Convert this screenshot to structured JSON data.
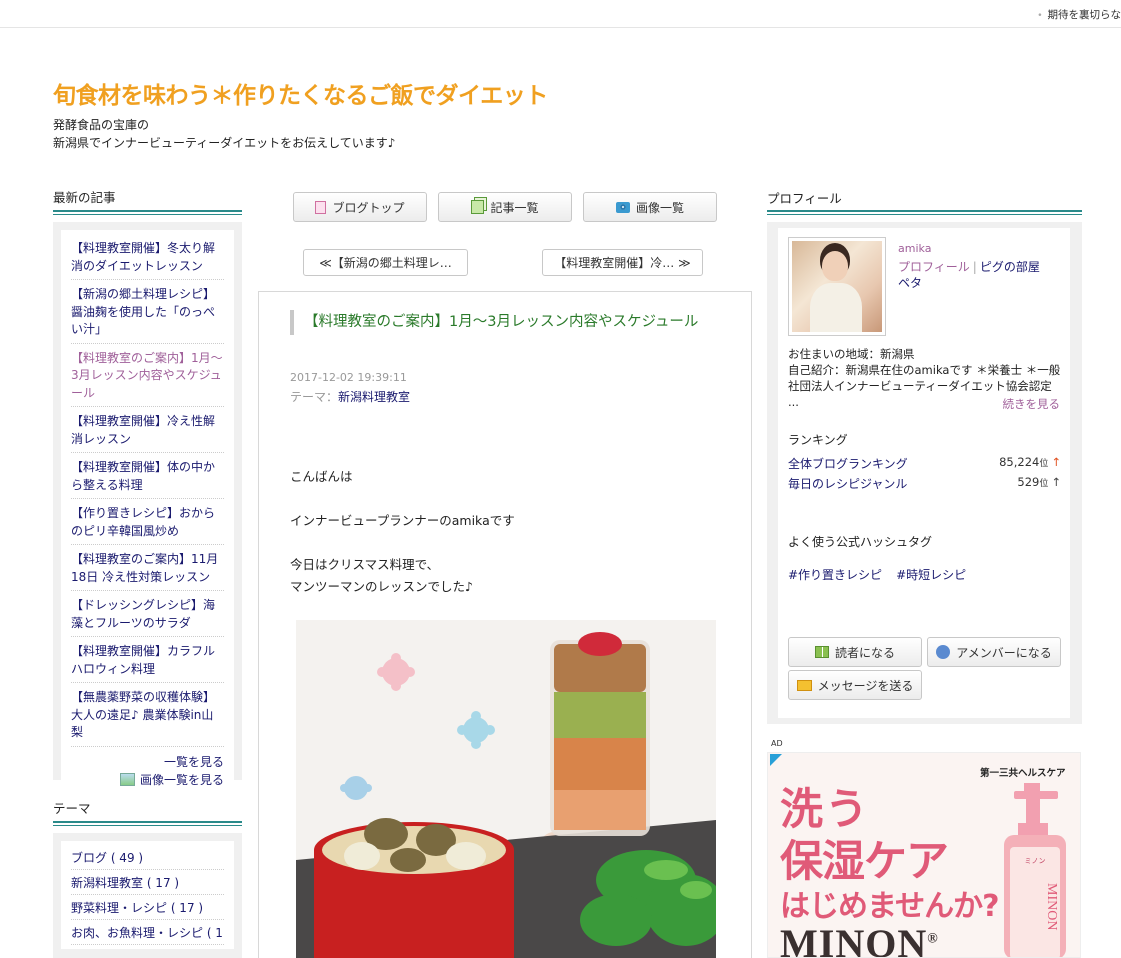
{
  "topbar": {
    "notice": "期待を裏切らな"
  },
  "blog": {
    "title": "旬食材を味わう＊作りたくなるご飯でダイエット",
    "desc_line1": "発酵食品の宝庫の",
    "desc_line2": "新潟県でインナービューティーダイエットをお伝えしています♪"
  },
  "left": {
    "recent_heading": "最新の記事",
    "recent_items": [
      "【料理教室開催】冬太り解消のダイエットレッスン",
      "【新潟の郷土料理レシピ】醤油麹を使用した「のっぺい汁」",
      "【料理教室のご案内】1月〜3月レッスン内容やスケジュール",
      "【料理教室開催】冷え性解消レッスン",
      "【料理教室開催】体の中から整える料理",
      "【作り置きレシピ】おからのピリ辛韓国風炒め",
      "【料理教室のご案内】11月18日 冷え性対策レッスン",
      "【ドレッシングレシピ】海藻とフルーツのサラダ",
      "【料理教室開催】カラフルハロウィン料理",
      "【無農薬野菜の収穫体験】大人の遠足♪ 農業体験in山梨"
    ],
    "list_all": "一覧を見る",
    "image_list": "画像一覧を見る",
    "theme_heading": "テーマ",
    "themes": [
      "ブログ ( 49 )",
      "新潟料理教室 ( 17 )",
      "野菜料理・レシピ ( 17 )",
      "お肉、お魚料理・レシピ ( 1"
    ]
  },
  "nav": {
    "blog_top": "ブログトップ",
    "articles": "記事一覧",
    "images": "画像一覧",
    "prev": "≪【新潟の郷土料理レ…",
    "next": "【料理教室開催】冷… ≫"
  },
  "article": {
    "title": "【料理教室のご案内】1月〜3月レッスン内容やスケジュール",
    "date": "2017-12-02 19:39:11",
    "theme_label": "テーマ：",
    "theme": "新潟料理教室",
    "p1": "こんばんは",
    "p2": "インナービュープランナーのamikaです",
    "p3a": "今日はクリスマス料理で、",
    "p3b": "マンツーマンのレッスンでした♪"
  },
  "profile": {
    "heading": "プロフィール",
    "name": "amika",
    "link_profile": "プロフィール",
    "link_room": "ピグの部屋",
    "link_peta": "ペタ",
    "residence": "お住まいの地域：新潟県",
    "intro1": "自己紹介：新潟県在住のamikaです ＊栄養士 ＊一般",
    "intro2": "社団法人インナービューティーダイエット協会認定 ...",
    "more": "続きを見る",
    "ranking_heading": "ランキング",
    "rank1_label": "全体ブログランキング",
    "rank1_value": "85,224",
    "rank1_unit": "位",
    "rank2_label": "毎日のレシピジャンル",
    "rank2_value": "529",
    "rank2_unit": "位",
    "hashtag_heading": "よく使う公式ハッシュタグ",
    "hashtags": [
      "#作り置きレシピ",
      "#時短レシピ"
    ],
    "btn_reader": "読者になる",
    "btn_member": "アメンバーになる",
    "btn_message": "メッセージを送る"
  },
  "ad": {
    "label": "AD",
    "brand": "第一三共ヘルスケア",
    "line1": "洗う",
    "line2": "保湿ケア",
    "line3": "はじめませんか?",
    "line4": "MINON",
    "reg": "®",
    "bottle_text": "MINON",
    "bottle_jp": "ミノン"
  },
  "colors": {
    "title_orange": "#f0a020",
    "teal_rule": "#2a8a8a",
    "article_title_green": "#2a7a2a",
    "link_purple": "#a0609a",
    "ad_pink": "#e05a78"
  }
}
